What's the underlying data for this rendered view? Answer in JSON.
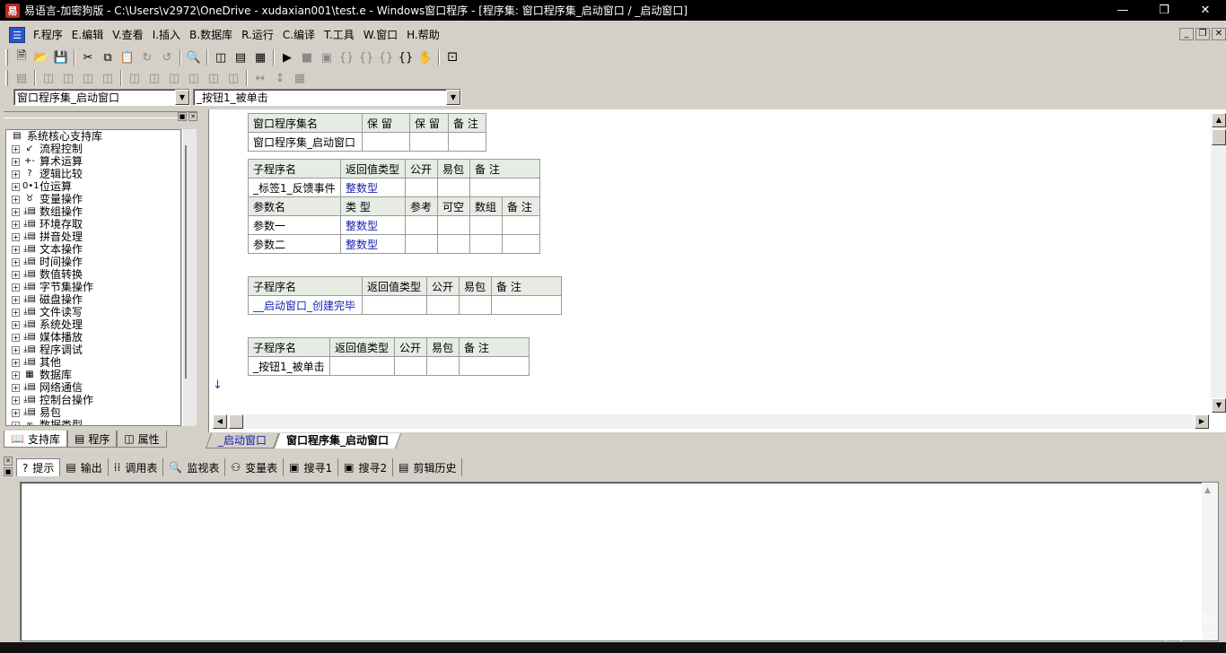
{
  "window": {
    "title": "易语言-加密狗版 - C:\\Users\\v2972\\OneDrive - xudaxian001\\test.e - Windows窗口程序 - [程序集: 窗口程序集_启动窗口 / _启动窗口]",
    "app_icon": "易"
  },
  "menu": [
    {
      "label": "F.程序"
    },
    {
      "label": "E.编辑"
    },
    {
      "label": "V.查看"
    },
    {
      "label": "I.插入"
    },
    {
      "label": "B.数据库"
    },
    {
      "label": "R.运行"
    },
    {
      "label": "C.编译"
    },
    {
      "label": "T.工具"
    },
    {
      "label": "W.窗口"
    },
    {
      "label": "H.帮助"
    }
  ],
  "combos": {
    "left": "窗口程序集_启动窗口",
    "right": "_按钮1_被单击"
  },
  "tree": {
    "root": "系统核心支持库",
    "items": [
      {
        "label": "流程控制",
        "icon": "↙"
      },
      {
        "label": "算术运算",
        "icon": "+-"
      },
      {
        "label": "逻辑比较",
        "icon": "?"
      },
      {
        "label": "位运算",
        "icon": "0•1"
      },
      {
        "label": "变量操作",
        "icon": "♉"
      },
      {
        "label": "数组操作",
        "icon": "⤓▤"
      },
      {
        "label": "环境存取",
        "icon": "⤓▤"
      },
      {
        "label": "拼音处理",
        "icon": "⤓▤"
      },
      {
        "label": "文本操作",
        "icon": "⤓▤"
      },
      {
        "label": "时间操作",
        "icon": "⤓▤"
      },
      {
        "label": "数值转换",
        "icon": "⤓▤"
      },
      {
        "label": "字节集操作",
        "icon": "⤓▤"
      },
      {
        "label": "磁盘操作",
        "icon": "⤓▤"
      },
      {
        "label": "文件读写",
        "icon": "⤓▤"
      },
      {
        "label": "系统处理",
        "icon": "⤓▤"
      },
      {
        "label": "媒体播放",
        "icon": "⤓▤"
      },
      {
        "label": "程序调试",
        "icon": "⤓▤"
      },
      {
        "label": "其他",
        "icon": "⤓▤"
      },
      {
        "label": "数据库",
        "icon": "▦"
      },
      {
        "label": "网络通信",
        "icon": "⤓▤"
      },
      {
        "label": "控制台操作",
        "icon": "⤓▤"
      },
      {
        "label": "易包",
        "icon": "⤓▤"
      },
      {
        "label": "数据类型",
        "icon": "∞"
      }
    ]
  },
  "left_tabs": [
    {
      "label": "支持库",
      "icon": "book-icon"
    },
    {
      "label": "程序",
      "icon": "program-icon"
    },
    {
      "label": "属性",
      "icon": "property-icon"
    }
  ],
  "editor": {
    "assembly_table": {
      "headers": [
        "窗口程序集名",
        "保 留",
        "保 留",
        "备 注"
      ],
      "row": [
        "窗口程序集_启动窗口",
        "",
        "",
        ""
      ]
    },
    "sub1": {
      "headers": [
        "子程序名",
        "返回值类型",
        "公开",
        "易包",
        "备 注"
      ],
      "row": [
        "_标签1_反馈事件",
        "整数型",
        "",
        "",
        ""
      ],
      "param_headers": [
        "参数名",
        "类 型",
        "参考",
        "可空",
        "数组",
        "备 注"
      ],
      "params": [
        [
          "参数一",
          "整数型",
          "",
          "",
          "",
          ""
        ],
        [
          "参数二",
          "整数型",
          "",
          "",
          "",
          ""
        ]
      ]
    },
    "sub2": {
      "headers": [
        "子程序名",
        "返回值类型",
        "公开",
        "易包",
        "备 注"
      ],
      "row": [
        "__启动窗口_创建完毕",
        "",
        "",
        "",
        ""
      ]
    },
    "sub3": {
      "headers": [
        "子程序名",
        "返回值类型",
        "公开",
        "易包",
        "备 注"
      ],
      "row": [
        "_按钮1_被单击",
        "",
        "",
        "",
        ""
      ]
    }
  },
  "editor_tabs": [
    {
      "label": "_启动窗口"
    },
    {
      "label": "窗口程序集_启动窗口"
    }
  ],
  "bottom_tabs": [
    {
      "label": "提示",
      "icon": "?"
    },
    {
      "label": "输出",
      "icon": "▤"
    },
    {
      "label": "调用表",
      "icon": "⁞⁞"
    },
    {
      "label": "监视表",
      "icon": "🔍"
    },
    {
      "label": "变量表",
      "icon": "⚇"
    },
    {
      "label": "搜寻1",
      "icon": "▣"
    },
    {
      "label": "搜寻2",
      "icon": "▣"
    },
    {
      "label": "剪辑历史",
      "icon": "▤"
    }
  ],
  "watermark": {
    "line1": "吾爱破解论坛",
    "line2": "www.52pojie.cn"
  }
}
